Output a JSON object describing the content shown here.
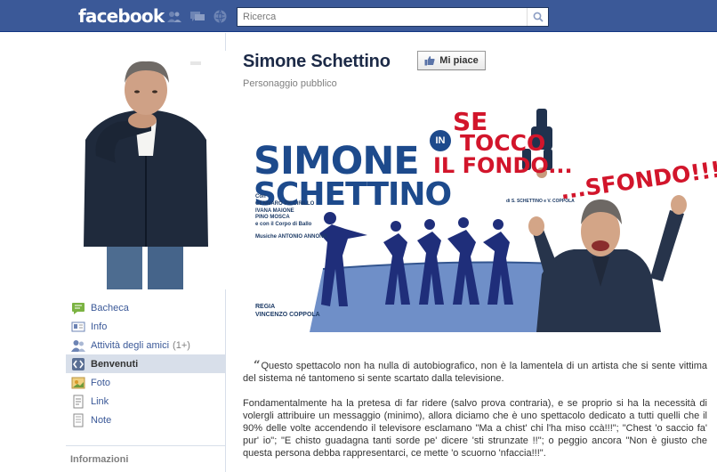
{
  "header": {
    "logo": "facebook",
    "search_placeholder": "Ricerca",
    "jewels": [
      "friend-requests-icon",
      "messages-icon",
      "notifications-icon"
    ]
  },
  "sidebar": {
    "items": [
      {
        "label": "Bacheca",
        "icon": "wall-icon"
      },
      {
        "label": "Info",
        "icon": "info-icon"
      },
      {
        "label": "Attività degli amici",
        "count": "(1+)",
        "icon": "friends-activity-icon"
      },
      {
        "label": "Benvenuti",
        "icon": "welcome-app-icon",
        "active": true
      },
      {
        "label": "Foto",
        "icon": "photos-icon"
      },
      {
        "label": "Link",
        "icon": "link-icon"
      },
      {
        "label": "Note",
        "icon": "notes-icon"
      }
    ],
    "info_heading": "Informazioni"
  },
  "page": {
    "title": "Simone Schettino",
    "like_label": "Mi piace",
    "category": "Personaggio pubblico"
  },
  "banner": {
    "name_line1": "SIMONE",
    "name_line2": "SCHETTINO",
    "in_badge": "IN",
    "phrase_line1": "SE",
    "phrase_line2": "TOCCO",
    "phrase_line3": "IL FONDO...",
    "phrase_line4": "...SFONDO!!!",
    "small_credit": "di S. SCHETTINO e V. COPPOLA",
    "credits_heading": "Con",
    "cast": [
      "GENNARO PICCIRILLO",
      "IVANA MAIONE",
      "PINO MOSCA"
    ],
    "cast_note": "e con il Corpo di Ballo",
    "music": "Musiche ANTONIO ANNONA",
    "regia_label": "REGIA",
    "regia_name": "VINCENZO COPPOLA"
  },
  "content": {
    "paragraph1": "Questo spettacolo non ha nulla di autobiografico, non è la lamentela di un artista che si sente vittima del sistema né tantomeno si sente scartato dalla televisione.",
    "paragraph2": "Fondamentalmente ha la pretesa di far ridere (salvo prova contraria), e se proprio si ha la necessità di volergli attribuire un messaggio (minimo), allora diciamo che è uno spettacolo dedicato a tutti quelli che il 90% delle volte accendendo il televisore esclamano \"Ma a chist' chi l'ha miso ccà!!!\"; \"Chest 'o saccio fa' pur' io\"; \"E chisto guadagna tanti sorde pe' dicere 'sti strunzate !!\"; o peggio ancora \"Non è giusto che questa persona debba rappresentarci, ce mette 'o scuorno 'nfaccia!!!\"."
  },
  "colors": {
    "brand": "#3b5998",
    "link": "#3b5998",
    "active_nav": "#d8dfea",
    "banner_blue": "#1d4a8c",
    "banner_red": "#d2152b"
  }
}
